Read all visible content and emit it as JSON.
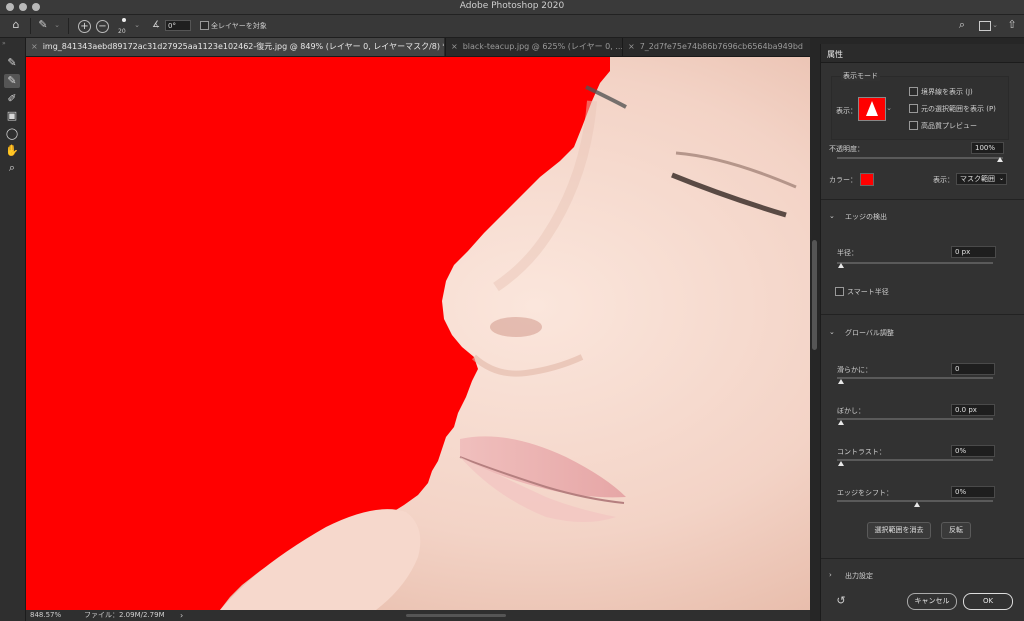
{
  "app": {
    "title": "Adobe Photoshop 2020"
  },
  "options": {
    "brush_size": "20",
    "angle": "0°",
    "all_layers_label": "全レイヤーを対象"
  },
  "tabs": [
    {
      "label": "img_841343aebd89172ac31d27925aa1123e102462-復元.jpg @ 849% (レイヤー 0, レイヤーマスク/8) *",
      "active": true
    },
    {
      "label": "black-teacup.jpg @ 625% (レイヤー 0, ...",
      "active": false
    },
    {
      "label": "7_2d7fe75e74b86b7696cb6564ba949bd",
      "active": false
    }
  ],
  "status": {
    "zoom": "848.57%",
    "file": "ファイル：2.09M/2.79M",
    "arrow": "›"
  },
  "panel": {
    "tab_label": "属性",
    "view_mode": {
      "group_label": "表示モード",
      "view_label": "表示：",
      "show_edge": "境界線を表示 (J)",
      "show_original": "元の選択範囲を表示 (P)",
      "hq_preview": "高品質プレビュー"
    },
    "opacity_label": "不透明度：",
    "opacity_value": "100%",
    "color_label": "カラー：",
    "display_label": "表示：",
    "display_value": "マスク範囲",
    "edge_detection": {
      "title": "エッジの検出",
      "radius_label": "半径：",
      "radius_value": "0 px",
      "smart_radius": "スマート半径"
    },
    "global": {
      "title": "グローバル調整",
      "smooth_label": "滑らかに：",
      "smooth_value": "0",
      "feather_label": "ぼかし：",
      "feather_value": "0.0 px",
      "contrast_label": "コントラスト：",
      "contrast_value": "0%",
      "shift_label": "エッジをシフト：",
      "shift_value": "0%",
      "clear_selection": "選択範囲を消去",
      "invert": "反転"
    },
    "output_title": "出力設定",
    "cancel": "キャンセル",
    "ok": "OK"
  },
  "colors": {
    "mask_overlay": "#ff0000",
    "panel_bg": "#323232",
    "app_bg": "#262626"
  },
  "icons": [
    "home-icon",
    "brush-tool-icon",
    "add-icon",
    "subtract-icon",
    "angle-icon",
    "search-icon",
    "workspace-icon",
    "share-icon",
    "lasso-icon",
    "hand-icon",
    "zoom-icon",
    "reset-icon"
  ]
}
